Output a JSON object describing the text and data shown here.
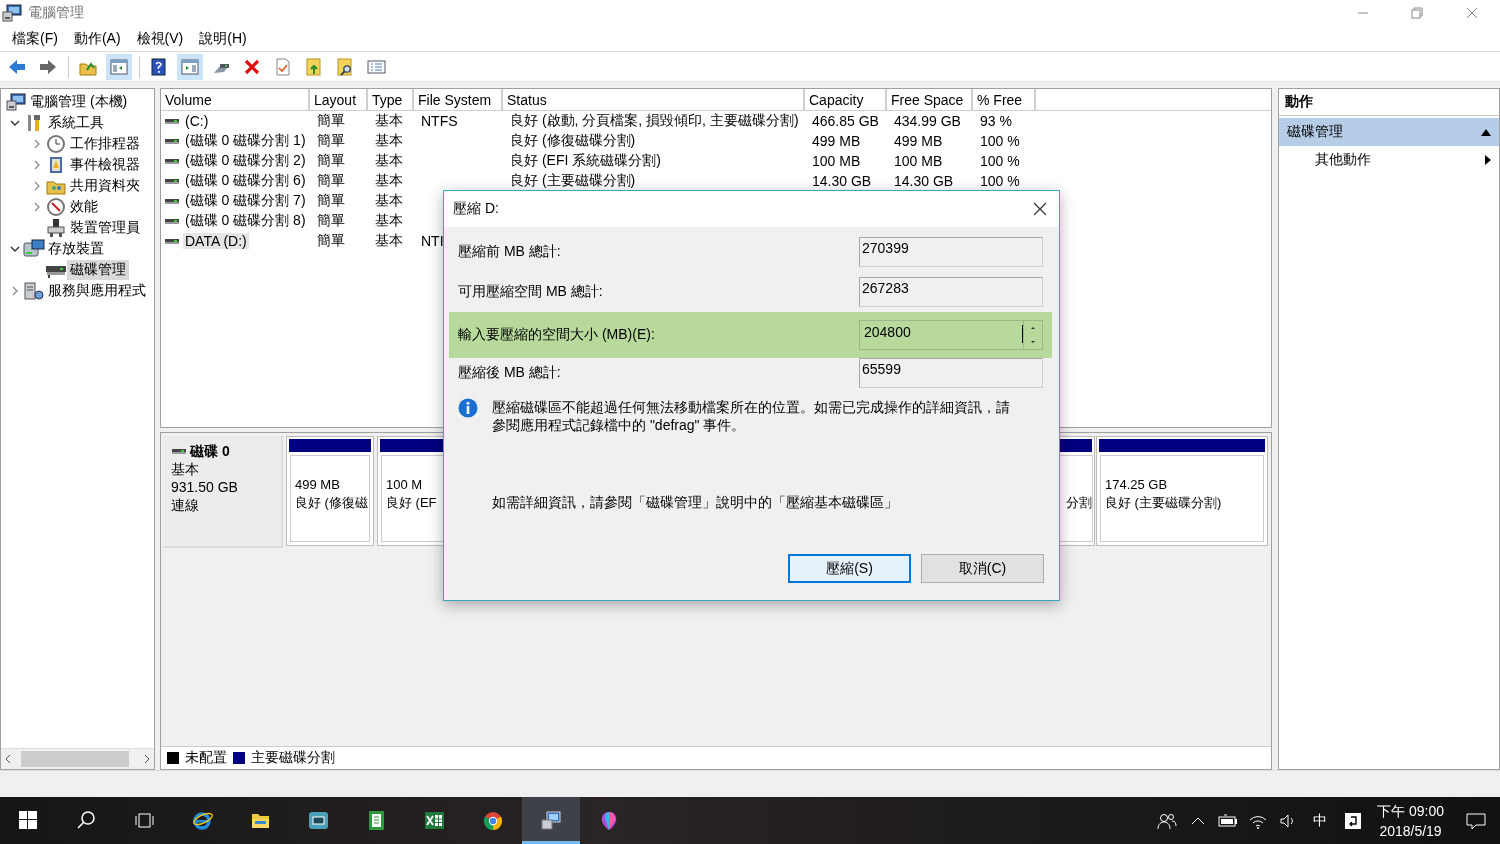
{
  "window": {
    "title": "電腦管理"
  },
  "menu": [
    "檔案(F)",
    "動作(A)",
    "檢視(V)",
    "說明(H)"
  ],
  "toolbar": [
    {
      "pressed": false
    },
    {
      "pressed": false
    },
    {
      "pressed": false
    },
    {
      "pressed": true
    },
    {
      "pressed": false
    },
    {
      "pressed": true
    },
    {
      "pressed": false
    },
    {
      "pressed": false
    },
    {
      "pressed": false
    },
    {
      "pressed": false
    },
    {
      "pressed": false
    },
    {
      "pressed": false
    }
  ],
  "tree": [
    {
      "label": "電腦管理 (本機)",
      "selected": false,
      "children": [
        {
          "label": "系統工具",
          "expanded": true,
          "selected": false,
          "children": [
            {
              "label": "工作排程器",
              "expanded": false,
              "selected": false
            },
            {
              "label": "事件檢視器",
              "expanded": false,
              "selected": false
            },
            {
              "label": "共用資料夾",
              "expanded": false,
              "selected": false
            },
            {
              "label": "效能",
              "expanded": false,
              "selected": false
            },
            {
              "label": "裝置管理員",
              "selected": false
            }
          ]
        },
        {
          "label": "存放裝置",
          "expanded": true,
          "selected": false,
          "children": [
            {
              "label": "磁碟管理",
              "selected": true
            }
          ]
        },
        {
          "label": "服務與應用程式",
          "expanded": false,
          "selected": false
        }
      ]
    }
  ],
  "table": {
    "columns": [
      "Volume",
      "Layout",
      "Type",
      "File System",
      "Status",
      "Capacity",
      "Free Space",
      "% Free"
    ],
    "rows": [
      {
        "selected": false,
        "cells": [
          "(C:)",
          "簡單",
          "基本",
          "NTFS",
          "良好 (啟動, 分頁檔案, 損毀傾印, 主要磁碟分割)",
          "466.85 GB",
          "434.99 GB",
          "93 %"
        ]
      },
      {
        "selected": false,
        "cells": [
          "(磁碟 0 磁碟分割 1)",
          "簡單",
          "基本",
          null,
          "良好 (修復磁碟分割)",
          "499 MB",
          "499 MB",
          "100 %"
        ]
      },
      {
        "selected": false,
        "cells": [
          "(磁碟 0 磁碟分割 2)",
          "簡單",
          "基本",
          null,
          "良好 (EFI 系統磁碟分割)",
          "100 MB",
          "100 MB",
          "100 %"
        ]
      },
      {
        "selected": false,
        "cells": [
          "(磁碟 0 磁碟分割 6)",
          "簡單",
          "基本",
          null,
          "良好 (主要磁碟分割)",
          "14.30 GB",
          "14.30 GB",
          "100 %"
        ]
      },
      {
        "selected": false,
        "cells": [
          "(磁碟 0 磁碟分割 7)",
          "簡單",
          "基本"
        ]
      },
      {
        "selected": false,
        "cells": [
          "(磁碟 0 磁碟分割 8)",
          "簡單",
          "基本"
        ]
      },
      {
        "selected": true,
        "cells": [
          "DATA (D:)",
          "簡單",
          "基本",
          "NTI"
        ]
      }
    ]
  },
  "disk_map": {
    "disk": {
      "name": "磁碟 0",
      "type": "基本",
      "size": "931.50 GB",
      "status": "連線"
    },
    "partitions": [
      {
        "kind": "partition",
        "size": "499 MB",
        "status": "良好 (修復磁"
      },
      {
        "kind": "partition",
        "size": "100 M",
        "status": "良好 (EF"
      },
      {
        "kind": "partial",
        "status": "分割"
      },
      {
        "kind": "partition",
        "size": "174.25 GB",
        "status": "良好 (主要磁碟分割)"
      }
    ],
    "legend": [
      {
        "label": "未配置",
        "color": "#000000"
      },
      {
        "label": "主要磁碟分割",
        "color": "#000080"
      }
    ]
  },
  "actions": {
    "title": "動作",
    "sections": [
      {
        "label": "磁碟管理",
        "expanded": true,
        "items": [
          "其他動作"
        ]
      }
    ]
  },
  "dialog": {
    "title": "壓縮 D:",
    "fields": [
      {
        "kind": "readonly",
        "label": "壓縮前 MB 總計:",
        "value": "270399",
        "highlighted": false
      },
      {
        "kind": "readonly",
        "label": "可用壓縮空間 MB 總計:",
        "value": "267283",
        "highlighted": false
      },
      {
        "kind": "spin",
        "label": "輸入要壓縮的空間大小 (MB)(E):",
        "value": "204800",
        "highlighted": true
      },
      {
        "kind": "readonly",
        "label": "壓縮後 MB 總計:",
        "value": "65599",
        "highlighted": false
      }
    ],
    "info": "壓縮磁碟區不能超過任何無法移動檔案所在的位置。如需已完成操作的詳細資訊，請參閱應用程式記錄檔中的 \"defrag\" 事件。",
    "help": "如需詳細資訊，請參閱「磁碟管理」說明中的「壓縮基本磁碟區」",
    "buttons": [
      {
        "label": "壓縮(S)",
        "default": true
      },
      {
        "label": "取消(C)",
        "default": false
      }
    ]
  },
  "taskbar": {
    "apps": [
      {
        "active": false
      },
      {
        "active": false
      },
      {
        "active": false
      },
      {
        "active": false
      },
      {
        "active": false
      },
      {
        "active": false
      },
      {
        "active": true
      },
      {
        "active": false
      }
    ],
    "ime": "中",
    "time": "下午 09:00",
    "date": "2018/5/19"
  }
}
